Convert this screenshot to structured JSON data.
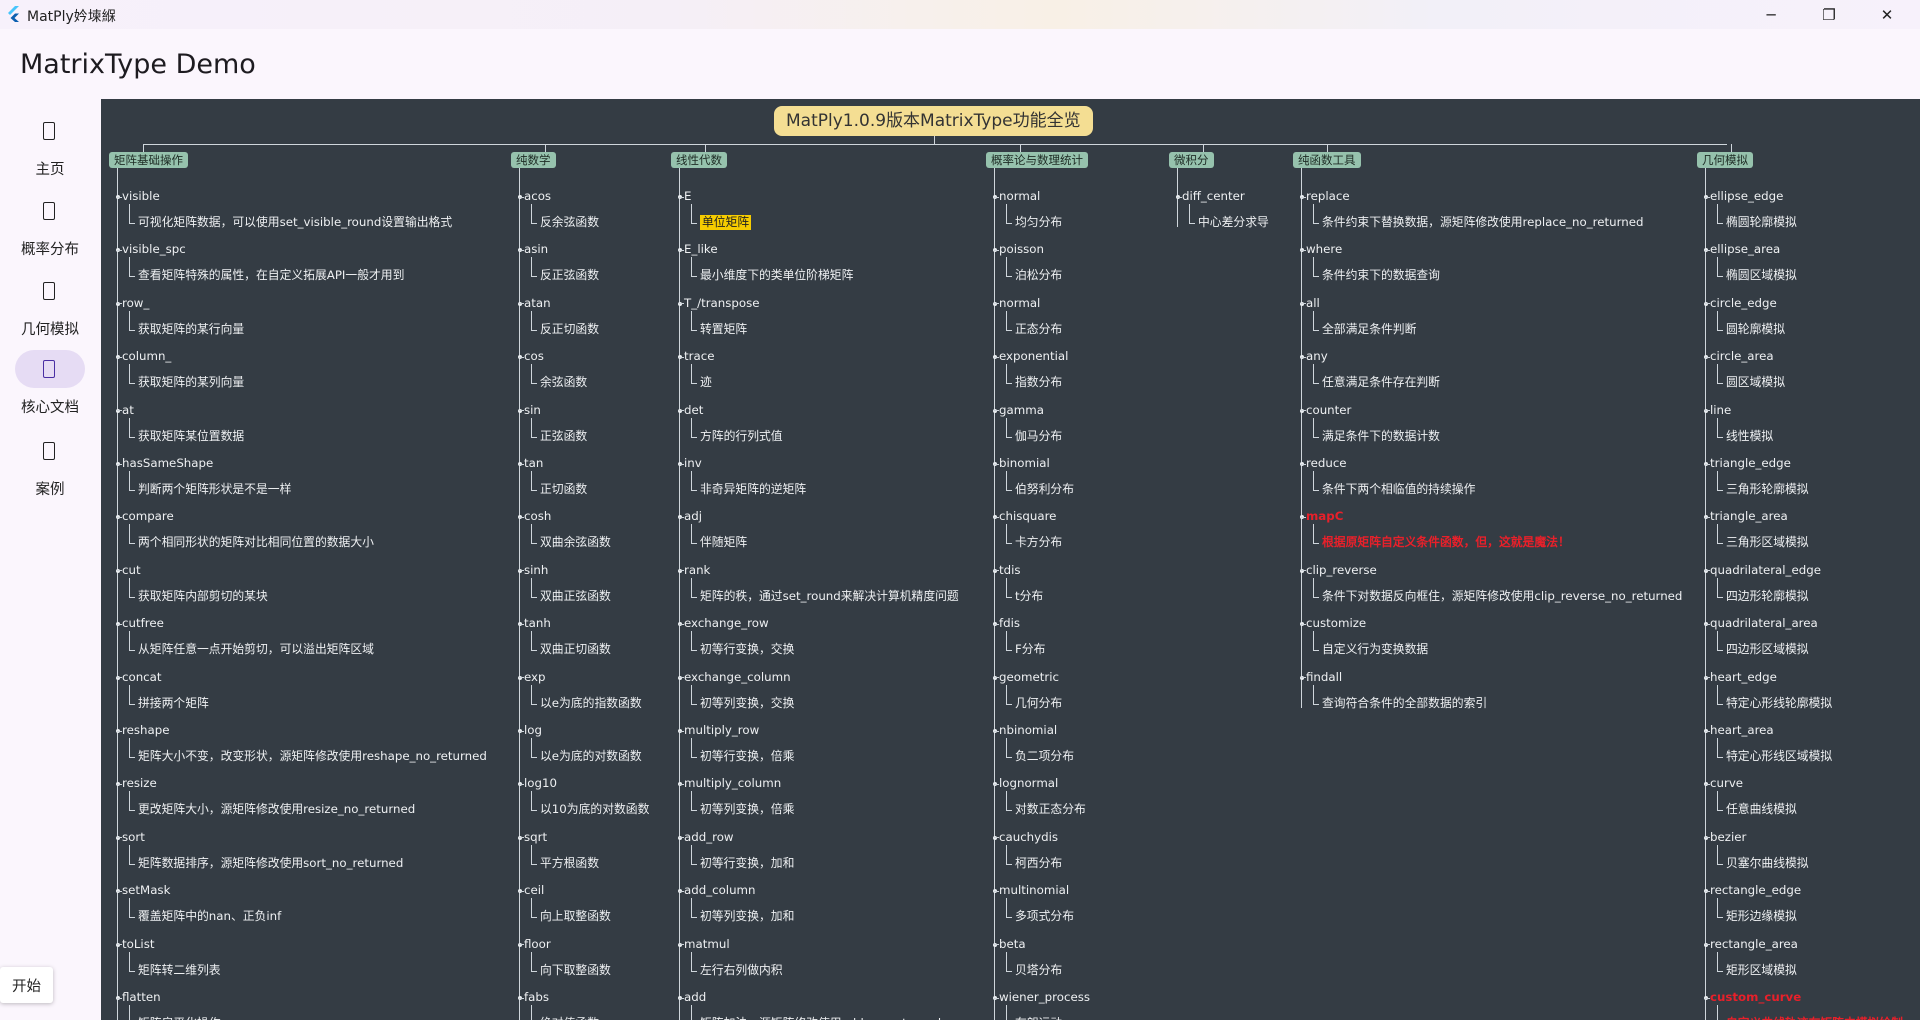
{
  "window": {
    "title": "MatPly妗堜緥"
  },
  "header": {
    "title": "MatrixType Demo"
  },
  "nav": [
    {
      "label": "主页",
      "active": false
    },
    {
      "label": "概率分布",
      "active": false
    },
    {
      "label": "几何模拟",
      "active": false
    },
    {
      "label": "核心文档",
      "active": true
    },
    {
      "label": "案例",
      "active": false
    }
  ],
  "start_label": "开始",
  "map": {
    "root": "MatPly1.0.9版本MatrixType功能全览",
    "categories": [
      {
        "label": "矩阵基础操作",
        "items": [
          {
            "name": "visible",
            "desc": "可视化矩阵数据，可以使用set_visible_round设置输出格式"
          },
          {
            "name": "visible_spc",
            "desc": "查看矩阵特殊的属性，在自定义拓展API一般才用到"
          },
          {
            "name": "row_",
            "desc": "获取矩阵的某行向量"
          },
          {
            "name": "column_",
            "desc": "获取矩阵的某列向量"
          },
          {
            "name": "at",
            "desc": "获取矩阵某位置数据"
          },
          {
            "name": "hasSameShape",
            "desc": "判断两个矩阵形状是不是一样"
          },
          {
            "name": "compare",
            "desc": "两个相同形状的矩阵对比相同位置的数据大小"
          },
          {
            "name": "cut",
            "desc": "获取矩阵内部剪切的某块"
          },
          {
            "name": "cutfree",
            "desc": "从矩阵任意一点开始剪切，可以溢出矩阵区域"
          },
          {
            "name": "concat",
            "desc": "拼接两个矩阵"
          },
          {
            "name": "reshape",
            "desc": "矩阵大小不变，改变形状，源矩阵修改使用reshape_no_returned"
          },
          {
            "name": "resize",
            "desc": "更改矩阵大小，源矩阵修改使用resize_no_returned"
          },
          {
            "name": "sort",
            "desc": "矩阵数据排序，源矩阵修改使用sort_no_returned"
          },
          {
            "name": "setMask",
            "desc": "覆盖矩阵中的nan、正负inf"
          },
          {
            "name": "toList",
            "desc": "矩阵转二维列表"
          },
          {
            "name": "flatten",
            "desc": "矩阵扁平化操作"
          }
        ]
      },
      {
        "label": "纯数学",
        "items": [
          {
            "name": "acos",
            "desc": "反余弦函数"
          },
          {
            "name": "asin",
            "desc": "反正弦函数"
          },
          {
            "name": "atan",
            "desc": "反正切函数"
          },
          {
            "name": "cos",
            "desc": "余弦函数"
          },
          {
            "name": "sin",
            "desc": "正弦函数"
          },
          {
            "name": "tan",
            "desc": "正切函数"
          },
          {
            "name": "cosh",
            "desc": "双曲余弦函数"
          },
          {
            "name": "sinh",
            "desc": "双曲正弦函数"
          },
          {
            "name": "tanh",
            "desc": "双曲正切函数"
          },
          {
            "name": "exp",
            "desc": "以e为底的指数函数"
          },
          {
            "name": "log",
            "desc": "以e为底的对数函数"
          },
          {
            "name": "log10",
            "desc": "以10为底的对数函数"
          },
          {
            "name": "sqrt",
            "desc": "平方根函数"
          },
          {
            "name": "ceil",
            "desc": "向上取整函数"
          },
          {
            "name": "floor",
            "desc": "向下取整函数"
          },
          {
            "name": "fabs",
            "desc": "绝对值函数"
          }
        ]
      },
      {
        "label": "线性代数",
        "items": [
          {
            "name": "E",
            "desc": "单位矩阵",
            "highlight": true
          },
          {
            "name": "E_like",
            "desc": "最小维度下的类单位阶梯矩阵"
          },
          {
            "name": "T_/transpose",
            "desc": "转置矩阵"
          },
          {
            "name": "trace",
            "desc": "迹"
          },
          {
            "name": "det",
            "desc": "方阵的行列式值"
          },
          {
            "name": "inv",
            "desc": "非奇异矩阵的逆矩阵"
          },
          {
            "name": "adj",
            "desc": "伴随矩阵"
          },
          {
            "name": "rank",
            "desc": "矩阵的秩，通过set_round来解决计算机精度问题"
          },
          {
            "name": "exchange_row",
            "desc": "初等行变换，交换"
          },
          {
            "name": "exchange_column",
            "desc": "初等列变换，交换"
          },
          {
            "name": "multiply_row",
            "desc": "初等行变换，倍乘"
          },
          {
            "name": "multiply_column",
            "desc": "初等列变换，倍乘"
          },
          {
            "name": "add_row",
            "desc": "初等行变换，加和"
          },
          {
            "name": "add_column",
            "desc": "初等列变换，加和"
          },
          {
            "name": "matmul",
            "desc": "左行右列做内积"
          },
          {
            "name": "add",
            "desc": "矩阵加法，源矩阵修改使用add_no_returned"
          }
        ]
      },
      {
        "label": "概率论与数理统计",
        "items": [
          {
            "name": "normal",
            "desc": "均匀分布"
          },
          {
            "name": "poisson",
            "desc": "泊松分布"
          },
          {
            "name": "normal",
            "desc": "正态分布"
          },
          {
            "name": "exponential",
            "desc": "指数分布"
          },
          {
            "name": "gamma",
            "desc": "伽马分布"
          },
          {
            "name": "binomial",
            "desc": "伯努利分布"
          },
          {
            "name": "chisquare",
            "desc": "卡方分布"
          },
          {
            "name": "tdis",
            "desc": "t分布"
          },
          {
            "name": "fdis",
            "desc": "F分布"
          },
          {
            "name": "geometric",
            "desc": "几何分布"
          },
          {
            "name": "nbinomial",
            "desc": "负二项分布"
          },
          {
            "name": "lognormal",
            "desc": "对数正态分布"
          },
          {
            "name": "cauchydis",
            "desc": "柯西分布"
          },
          {
            "name": "multinomial",
            "desc": "多项式分布"
          },
          {
            "name": "beta",
            "desc": "贝塔分布"
          },
          {
            "name": "wiener_process",
            "desc": "布朗运动"
          }
        ]
      },
      {
        "label": "微积分",
        "items": [
          {
            "name": "diff_center",
            "desc": "中心差分求导"
          }
        ]
      },
      {
        "label": "纯函数工具",
        "items": [
          {
            "name": "replace",
            "desc": "条件约束下替换数据，源矩阵修改使用replace_no_returned"
          },
          {
            "name": "where",
            "desc": "条件约束下的数据查询"
          },
          {
            "name": "all",
            "desc": "全部满足条件判断"
          },
          {
            "name": "any",
            "desc": "任意满足条件存在判断"
          },
          {
            "name": "counter",
            "desc": "满足条件下的数据计数"
          },
          {
            "name": "reduce",
            "desc": "条件下两个相临值的持续操作"
          },
          {
            "name": "mapC",
            "desc": "根据原矩阵自定义条件函数，但，这就是魔法！",
            "red": true
          },
          {
            "name": "clip_reverse",
            "desc": "条件下对数据反向框住，源矩阵修改使用clip_reverse_no_returned"
          },
          {
            "name": "customize",
            "desc": "自定义行为变换数据"
          },
          {
            "name": "findall",
            "desc": "查询符合条件的全部数据的索引"
          }
        ]
      },
      {
        "label": "几何模拟",
        "items": [
          {
            "name": "ellipse_edge",
            "desc": "椭圆轮廓模拟"
          },
          {
            "name": "ellipse_area",
            "desc": "椭圆区域模拟"
          },
          {
            "name": "circle_edge",
            "desc": "圆轮廓模拟"
          },
          {
            "name": "circle_area",
            "desc": "圆区域模拟"
          },
          {
            "name": "line",
            "desc": "线性模拟"
          },
          {
            "name": "triangle_edge",
            "desc": "三角形轮廓模拟"
          },
          {
            "name": "triangle_area",
            "desc": "三角形区域模拟"
          },
          {
            "name": "quadrilateral_edge",
            "desc": "四边形轮廓模拟"
          },
          {
            "name": "quadrilateral_area",
            "desc": "四边形区域模拟"
          },
          {
            "name": "heart_edge",
            "desc": "特定心形线轮廓模拟"
          },
          {
            "name": "heart_area",
            "desc": "特定心形线区域模拟"
          },
          {
            "name": "curve",
            "desc": "任意曲线模拟"
          },
          {
            "name": "bezier",
            "desc": "贝塞尔曲线模拟"
          },
          {
            "name": "rectangle_edge",
            "desc": "矩形边缘模拟"
          },
          {
            "name": "rectangle_area",
            "desc": "矩形区域模拟"
          },
          {
            "name": "custom_curve",
            "desc": "自定义曲线轨迹在矩阵中模拟绘制",
            "red": true
          }
        ]
      }
    ]
  }
}
